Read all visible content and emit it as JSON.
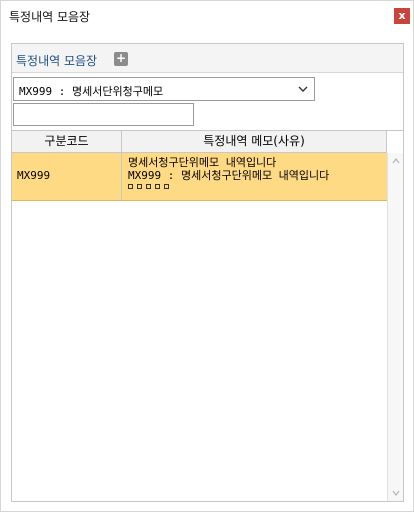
{
  "window": {
    "title": "특정내역 모음장",
    "close_label": "x"
  },
  "panel": {
    "title": "특정내역 모음장",
    "add_label": "+"
  },
  "select": {
    "selected": "MX999 : 명세서단위청구메모"
  },
  "input": {
    "value": "",
    "placeholder": ""
  },
  "grid": {
    "columns": [
      "구분코드",
      "특정내역 메모(사유)"
    ],
    "rows": [
      {
        "code": "MX999",
        "memo_line1": "명세서청구단위메모 내역입니다",
        "memo_line2": "MX999 : 명세서청구단위메모 내역입니다"
      }
    ]
  },
  "colors": {
    "selected_row": "#ffda85",
    "title_text": "#1f4f86",
    "close_button": "#c9453c"
  },
  "icons": [
    "close-icon",
    "plus-icon",
    "chevron-down-icon",
    "scroll-up-icon",
    "scroll-down-icon"
  ]
}
